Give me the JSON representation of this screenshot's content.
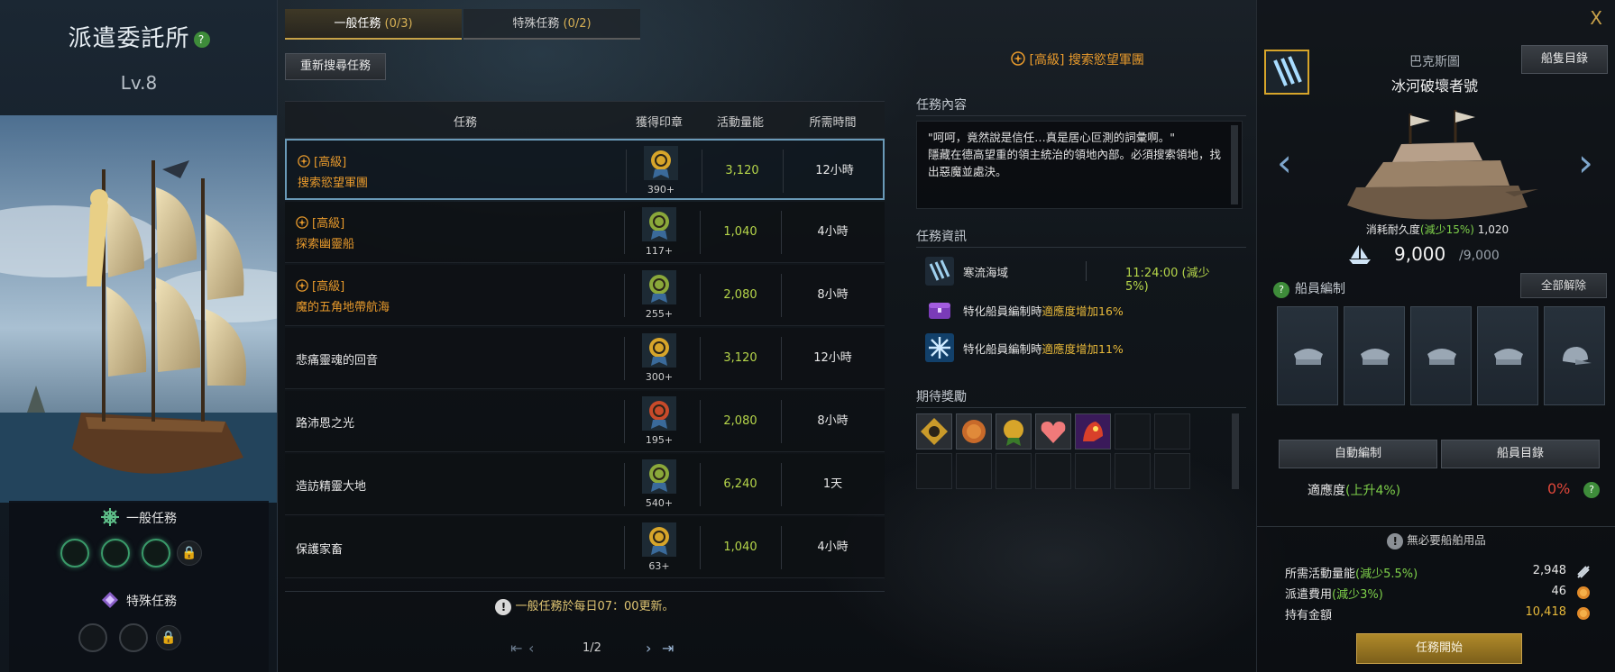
{
  "window": {
    "title": "派遣委託所",
    "level": "Lv.8",
    "help": "?",
    "close": "X"
  },
  "left_tasks": {
    "normal_label": "一般任務",
    "special_label": "特殊任務"
  },
  "tabs": [
    {
      "label": "一般任務",
      "count": "(0/3)"
    },
    {
      "label": "特殊任務",
      "count": "(0/2)"
    }
  ],
  "refresh_label": "重新搜尋任務",
  "list": {
    "headers": {
      "task": "任務",
      "seal": "獲得印章",
      "energy": "活動量能",
      "time": "所需時間"
    },
    "rows": [
      {
        "grade": "[高級]",
        "name": "搜索慾望軍團",
        "seal": "390+",
        "energy": "3,120",
        "time": "12小時",
        "medal_color": "#d7a52a"
      },
      {
        "grade": "[高級]",
        "name": "探索幽靈船",
        "seal": "117+",
        "energy": "1,040",
        "time": "4小時",
        "medal_color": "#8aa83a"
      },
      {
        "grade": "[高級]",
        "name": "魔的五角地帶航海",
        "seal": "255+",
        "energy": "2,080",
        "time": "8小時",
        "medal_color": "#8aa83a"
      },
      {
        "grade": "",
        "name": "悲痛靈魂的回音",
        "seal": "300+",
        "energy": "3,120",
        "time": "12小時",
        "medal_color": "#d7a52a"
      },
      {
        "grade": "",
        "name": "路沛恩之光",
        "seal": "195+",
        "energy": "2,080",
        "time": "8小時",
        "medal_color": "#c84a2a"
      },
      {
        "grade": "",
        "name": "造訪精靈大地",
        "seal": "540+",
        "energy": "6,240",
        "time": "1天",
        "medal_color": "#8aa83a"
      },
      {
        "grade": "",
        "name": "保護家畜",
        "seal": "63+",
        "energy": "1,040",
        "time": "4小時",
        "medal_color": "#d7a52a"
      }
    ]
  },
  "notice": "一般任務於每日07：00更新。",
  "pager": {
    "page": "1/2"
  },
  "detail": {
    "title": "[高級] 搜索慾望軍團",
    "content_label": "任務內容",
    "description": "\"呵呵，竟然說是信任…真是居心叵測的詞彙啊。\"\n隱藏在德高望重的領主統治的領地內部。必須搜索領地，找出惡魔並處決。",
    "info_label": "任務資訊",
    "info": [
      {
        "text": "寒流海域",
        "time": "11:24:00 (減少5%)"
      },
      {
        "text_pre": "特化船員編制時",
        "text_hl": "適應度增加16%"
      },
      {
        "text_pre": "特化船員編制時",
        "text_hl": "適應度增加11%"
      }
    ],
    "rewards_label": "期待獎勵"
  },
  "ship": {
    "region": "巴克斯圖",
    "name": "冰河破壞者號",
    "list_button": "船隻目錄",
    "durability_pre": "消耗耐久度",
    "durability_hl": "(減少15%)",
    "durability_val": "1,020",
    "hp_current": "9,000",
    "hp_max": "/9,000",
    "crew_label": "船員編制",
    "release_all": "全部解除",
    "auto_button": "自動編制",
    "crew_list_button": "船員目錄",
    "adapt_label": "適應度",
    "adapt_hl": "(上升4%)",
    "adapt_value": "0%",
    "no_item": "無必要船舶用品",
    "costs": [
      {
        "label": "所需活動量能",
        "hl": "(減少5.5%)",
        "value": "2,948"
      },
      {
        "label": "派遣費用",
        "hl": "(減少3%)",
        "value": "46"
      },
      {
        "label": "持有金額",
        "hl": "",
        "value": "10,418"
      }
    ],
    "start_button": "任務開始"
  }
}
